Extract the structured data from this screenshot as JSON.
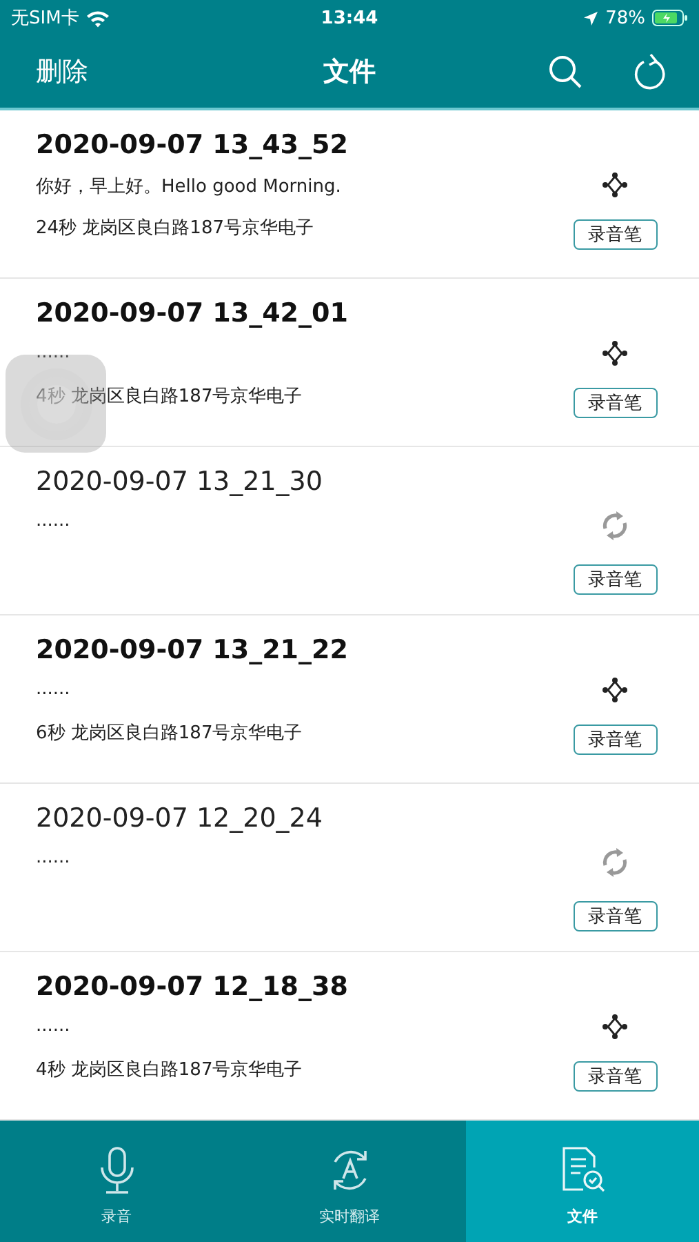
{
  "status_bar": {
    "carrier": "无SIM卡",
    "time": "13:44",
    "battery": "78%"
  },
  "nav_bar": {
    "left_action": "删除",
    "title": "文件"
  },
  "files": [
    {
      "title": "2020-09-07 13_43_52",
      "synced": true,
      "preview": "你好，早上好。Hello good Morning.",
      "info": "24秒 龙岗区良白路187号京华电子",
      "tag": "录音笔"
    },
    {
      "title": "2020-09-07 13_42_01",
      "synced": true,
      "preview": "......",
      "info": "4秒 龙岗区良白路187号京华电子",
      "tag": "录音笔"
    },
    {
      "title": "2020-09-07 13_21_30",
      "synced": false,
      "preview": "......",
      "tag": "录音笔"
    },
    {
      "title": "2020-09-07 13_21_22",
      "synced": true,
      "preview": "......",
      "info": "6秒 龙岗区良白路187号京华电子",
      "tag": "录音笔"
    },
    {
      "title": "2020-09-07 12_20_24",
      "synced": false,
      "preview": "......",
      "tag": "录音笔"
    },
    {
      "title": "2020-09-07 12_18_38",
      "synced": true,
      "preview": "......",
      "info": "4秒 龙岗区良白路187号京华电子",
      "tag": "录音笔"
    }
  ],
  "tab_bar": [
    {
      "kind": "mic",
      "label": "录音",
      "selected": false
    },
    {
      "kind": "translate",
      "label": "实时翻译",
      "selected": false
    },
    {
      "kind": "files",
      "label": "文件",
      "selected": true
    }
  ]
}
